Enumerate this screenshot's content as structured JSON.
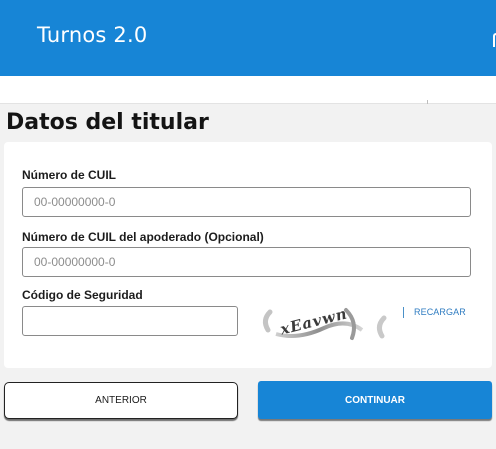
{
  "header": {
    "app_title": "Turnos 2.0"
  },
  "page": {
    "title": "Datos del titular"
  },
  "form": {
    "cuil": {
      "label": "Número de CUIL",
      "placeholder": "00-00000000-0",
      "value": ""
    },
    "cuil_apoderado": {
      "label": "Número de CUIL del apoderado (Opcional)",
      "placeholder": "00-00000000-0",
      "value": ""
    },
    "security_code": {
      "label": "Código de Seguridad",
      "value": "",
      "captcha_text": "xEavwn",
      "reload_label": "RECARGAR"
    }
  },
  "actions": {
    "back_label": "ANTERIOR",
    "continue_label": "CONTINUAR"
  },
  "colors": {
    "brand": "#1785d6",
    "link": "#2f7cc1",
    "background": "#f2f2f2"
  }
}
